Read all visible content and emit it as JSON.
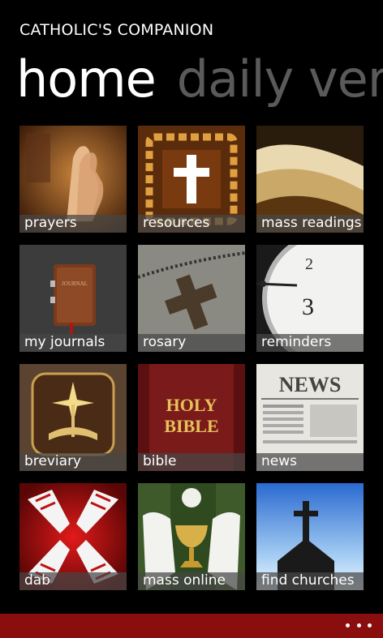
{
  "app": {
    "title": "CATHOLIC'S COMPANION"
  },
  "pivot": {
    "active": "home",
    "next": "daily ver"
  },
  "tiles": [
    {
      "label": "prayers",
      "icon": "praying-hands-icon"
    },
    {
      "label": "resources",
      "icon": "cross-chain-icon"
    },
    {
      "label": "mass readings",
      "icon": "open-book-icon"
    },
    {
      "label": "my journals",
      "icon": "journal-icon"
    },
    {
      "label": "rosary",
      "icon": "rosary-cross-icon"
    },
    {
      "label": "reminders",
      "icon": "clock-icon"
    },
    {
      "label": "breviary",
      "icon": "breviary-icon"
    },
    {
      "label": "bible",
      "icon": "holy-bible-icon"
    },
    {
      "label": "news",
      "icon": "newspaper-icon"
    },
    {
      "label": "dab",
      "icon": "dab-cross-icon"
    },
    {
      "label": "mass online",
      "icon": "chalice-icon"
    },
    {
      "label": "find churches",
      "icon": "church-icon"
    }
  ],
  "tile_art": {
    "journal_text": "JOURNAL",
    "bible_line1": "HOLY",
    "bible_line2": "BIBLE",
    "news_text": "NEWS",
    "clock_2": "2",
    "clock_3": "3"
  },
  "appbar": {
    "more_icon": "ellipsis-icon",
    "color": "#8b0e0e"
  }
}
